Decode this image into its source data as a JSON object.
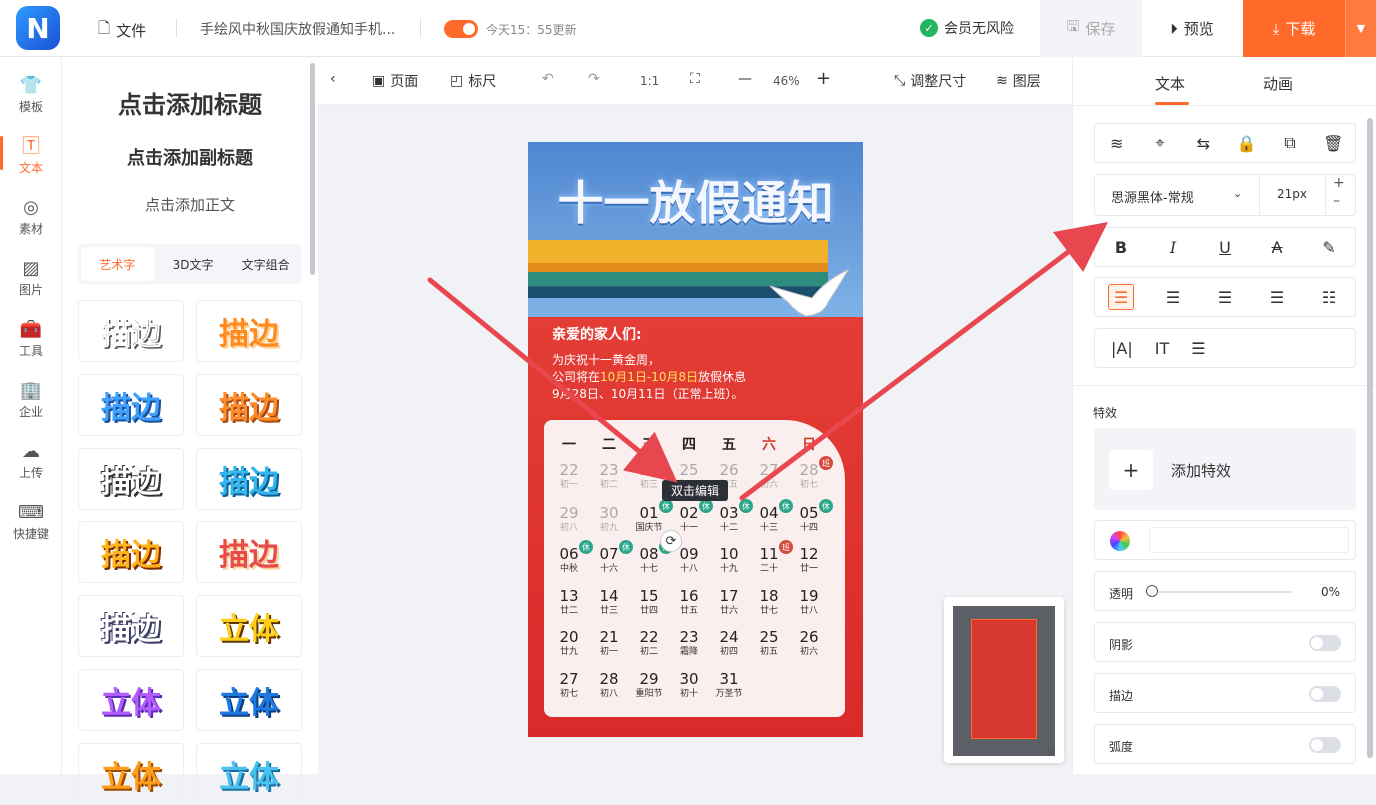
{
  "app": {
    "logo_letter": "N",
    "file_label": "文件",
    "doc_title": "手绘风中秋国庆放假通知手机...",
    "update_text": "今天15：55更新",
    "vip_text": "会员无风险",
    "save_label": "保存",
    "preview_label": "预览",
    "download_label": "下载"
  },
  "nav": [
    "模板",
    "文本",
    "素材",
    "图片",
    "工具",
    "企业",
    "上传",
    "快捷键"
  ],
  "text_panel": {
    "title": "点击添加标题",
    "subtitle": "点击添加副标题",
    "body": "点击添加正文",
    "tabs": [
      "艺术字",
      "3D文字",
      "文字组合"
    ],
    "tiles": [
      "描边",
      "描边",
      "描边",
      "描边",
      "描边",
      "描边",
      "描边",
      "描边",
      "描边",
      "描边",
      "描边",
      "立体",
      "立体",
      "立体",
      "立体",
      "立体"
    ]
  },
  "canvas_toolbar": {
    "page": "页面",
    "ruler": "标尺",
    "ratio": "1:1",
    "zoom": "46%",
    "resize": "调整尺寸",
    "layers": "图层"
  },
  "right_panel": {
    "tabs": [
      "文本",
      "动画"
    ],
    "font_name": "思源黑体-常规",
    "font_size": "21px",
    "effects_label": "特效",
    "add_effect": "添加特效",
    "opacity_label": "透明",
    "opacity_value": "0%",
    "shadow_label": "阴影",
    "stroke_label": "描边",
    "curve_label": "弧度"
  },
  "poster": {
    "title": "十一放假通知",
    "greeting": "亲爱的家人们:",
    "line1": "为庆祝十一黄金周，",
    "line2_a": "公司将在",
    "line2_hl": "10月1日-10月8日",
    "line2_b": "放假休息",
    "line3": "9月28日、10月11日（正常上班）。",
    "weekdays": [
      "一",
      "二",
      "三",
      "四",
      "五",
      "六",
      "日"
    ],
    "rows": [
      [
        [
          "22",
          "初一"
        ],
        [
          "23",
          "初二"
        ],
        [
          "24",
          "初三"
        ],
        [
          "25",
          "初四"
        ],
        [
          "26",
          "初五"
        ],
        [
          "27",
          "初六"
        ],
        [
          "28",
          "初七"
        ]
      ],
      [
        [
          "29",
          "初八"
        ],
        [
          "30",
          "初九"
        ],
        [
          "01",
          "国庆节"
        ],
        [
          "02",
          "十一"
        ],
        [
          "03",
          "十二"
        ],
        [
          "04",
          "十三"
        ],
        [
          "05",
          "十四"
        ]
      ],
      [
        [
          "06",
          "中秋"
        ],
        [
          "07",
          "十六"
        ],
        [
          "08",
          "十七"
        ],
        [
          "09",
          "十八"
        ],
        [
          "10",
          "十九"
        ],
        [
          "11",
          "二十"
        ],
        [
          "12",
          "廿一"
        ]
      ],
      [
        [
          "13",
          "廿二"
        ],
        [
          "14",
          "廿三"
        ],
        [
          "15",
          "廿四"
        ],
        [
          "16",
          "廿五"
        ],
        [
          "17",
          "廿六"
        ],
        [
          "18",
          "廿七"
        ],
        [
          "19",
          "廿八"
        ]
      ],
      [
        [
          "20",
          "廿九"
        ],
        [
          "21",
          "初一"
        ],
        [
          "22",
          "初二"
        ],
        [
          "23",
          "霜降"
        ],
        [
          "24",
          "初四"
        ],
        [
          "25",
          "初五"
        ],
        [
          "26",
          "初六"
        ]
      ],
      [
        [
          "27",
          "初七"
        ],
        [
          "28",
          "初八"
        ],
        [
          "29",
          "重阳节"
        ],
        [
          "30",
          "初十"
        ],
        [
          "31",
          "万圣节"
        ]
      ]
    ],
    "rest_badge": "休",
    "work_badge": "班"
  },
  "tooltip": "双击编辑",
  "colors": {
    "accent": "#ff6a2b",
    "arrow": "#e8474f"
  }
}
